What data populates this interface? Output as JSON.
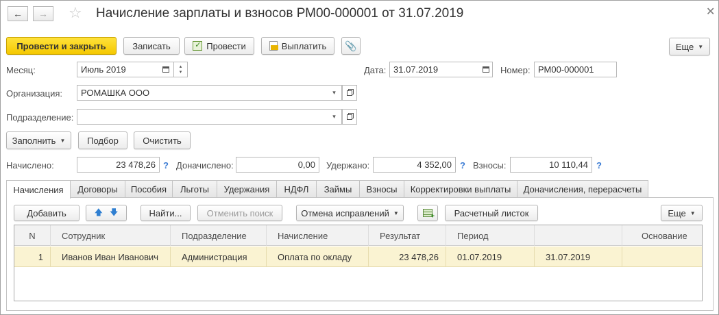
{
  "window": {
    "title": "Начисление зарплаты и взносов РМ00-000001 от 31.07.2019"
  },
  "toolbar": {
    "post_close": "Провести и закрыть",
    "save": "Записать",
    "post": "Провести",
    "pay": "Выплатить",
    "more": "Еще"
  },
  "form": {
    "month_label": "Месяц:",
    "month_value": "Июль 2019",
    "date_label": "Дата:",
    "date_value": "31.07.2019",
    "number_label": "Номер:",
    "number_value": "РМ00-000001",
    "org_label": "Организация:",
    "org_value": "РОМАШКА ООО",
    "dept_label": "Подразделение:",
    "dept_value": ""
  },
  "actions": {
    "fill": "Заполнить",
    "pick": "Подбор",
    "clear": "Очистить"
  },
  "totals": {
    "accrued_label": "Начислено:",
    "accrued_value": "23 478,26",
    "extra_label": "Доначислено:",
    "extra_value": "0,00",
    "withheld_label": "Удержано:",
    "withheld_value": "4 352,00",
    "contrib_label": "Взносы:",
    "contrib_value": "10 110,44",
    "help": "?"
  },
  "tabs": [
    "Начисления",
    "Договоры",
    "Пособия",
    "Льготы",
    "Удержания",
    "НДФЛ",
    "Займы",
    "Взносы",
    "Корректировки выплаты",
    "Доначисления, перерасчеты"
  ],
  "tab_toolbar": {
    "add": "Добавить",
    "find": "Найти...",
    "cancel_search": "Отменить поиск",
    "cancel_fixes": "Отмена исправлений",
    "payslip": "Расчетный листок",
    "more": "Еще"
  },
  "grid": {
    "columns": [
      "N",
      "Сотрудник",
      "Подразделение",
      "Начисление",
      "Результат",
      "Период",
      "",
      "Основание"
    ],
    "rows": [
      [
        "1",
        "Иванов Иван Иванович",
        "Администрация",
        "Оплата по окладу",
        "23 478,26",
        "01.07.2019",
        "31.07.2019",
        ""
      ]
    ]
  },
  "colors": {
    "primary_button": "#f5c800",
    "selected_row": "#faf3d2",
    "help_link": "#3b7cd4"
  }
}
